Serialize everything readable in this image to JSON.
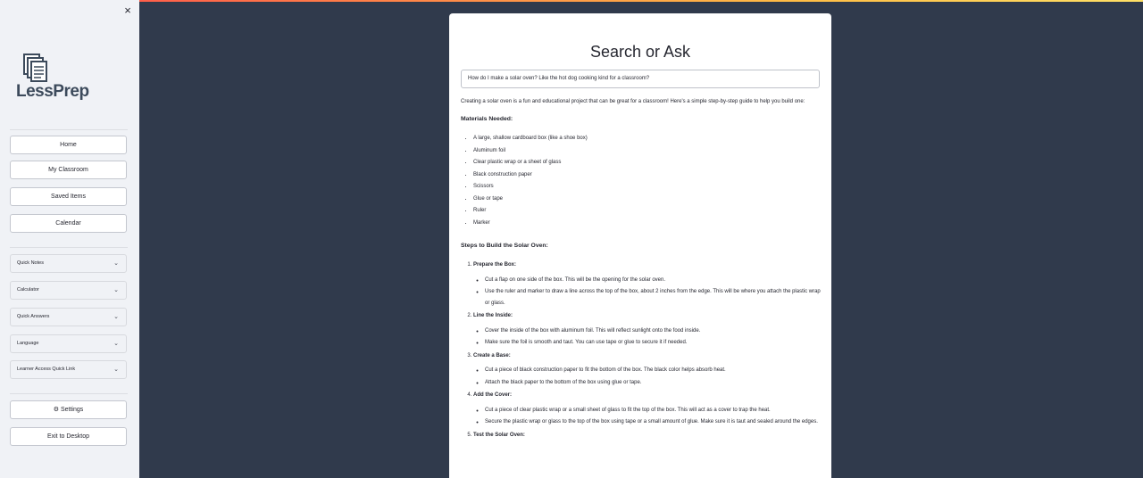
{
  "sidebar": {
    "logo_text": "LessPrep",
    "close_glyph": "×",
    "nav": [
      "Home",
      "My Classroom",
      "Saved Items",
      "Calendar"
    ],
    "expanders": [
      "Quick Notes",
      "Calculator",
      "Quick Answers",
      "Language",
      "Learner Access Quick Link"
    ],
    "settings_label": "⚙ Settings",
    "exit_label": "Exit to Desktop",
    "chevron_glyph": "⌄"
  },
  "main": {
    "title": "Search or Ask",
    "search_value": "How do I make a solar oven? Like the hot dog cooking kind for a classroom?",
    "intro": "Creating a solar oven is a fun and educational project that can be great for a classroom! Here's a simple step-by-step guide to help you build one:",
    "materials_heading": "Materials Needed:",
    "materials": [
      "A large, shallow cardboard box (like a shoe box)",
      "Aluminum foil",
      "Clear plastic wrap or a sheet of glass",
      "Black construction paper",
      "Scissors",
      "Glue or tape",
      "Ruler",
      "Marker"
    ],
    "steps_heading": "Steps to Build the Solar Oven:",
    "steps": [
      {
        "title": "Prepare the Box:",
        "items": [
          "Cut a flap on one side of the box. This will be the opening for the solar oven.",
          "Use the ruler and marker to draw a line across the top of the box, about 2 inches from the edge. This will be where you attach the plastic wrap or glass."
        ]
      },
      {
        "title": "Line the Inside:",
        "items": [
          "Cover the inside of the box with aluminum foil. This will reflect sunlight onto the food inside.",
          "Make sure the foil is smooth and taut. You can use tape or glue to secure it if needed."
        ]
      },
      {
        "title": "Create a Base:",
        "items": [
          "Cut a piece of black construction paper to fit the bottom of the box. The black color helps absorb heat.",
          "Attach the black paper to the bottom of the box using glue or tape."
        ]
      },
      {
        "title": "Add the Cover:",
        "items": [
          "Cut a piece of clear plastic wrap or a small sheet of glass to fit the top of the box. This will act as a cover to trap the heat.",
          "Secure the plastic wrap or glass to the top of the box using tape or a small amount of glue. Make sure it is taut and sealed around the edges."
        ]
      },
      {
        "title": "Test the Solar Oven:",
        "items": []
      }
    ]
  }
}
